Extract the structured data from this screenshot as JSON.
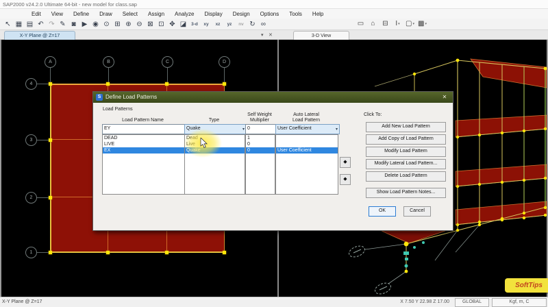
{
  "window": {
    "title": "SAP2000 v24.2.0 Ultimate 64-bit - new model for class.sap"
  },
  "menu": {
    "items": [
      "Edit",
      "View",
      "Define",
      "Draw",
      "Select",
      "Assign",
      "Analyze",
      "Display",
      "Design",
      "Options",
      "Tools",
      "Help"
    ]
  },
  "toolbar": {
    "left_icons": [
      {
        "name": "pointer",
        "glyph": "↖"
      },
      {
        "name": "save",
        "glyph": "▦"
      },
      {
        "name": "print",
        "glyph": "▤"
      },
      {
        "name": "undo",
        "glyph": "↶"
      },
      {
        "name": "redo",
        "glyph": "↷"
      },
      {
        "name": "draw",
        "glyph": "✎"
      },
      {
        "name": "lock",
        "glyph": "◙"
      },
      {
        "name": "run-analysis",
        "glyph": "▶"
      },
      {
        "name": "snap-point",
        "glyph": "◉"
      },
      {
        "name": "snap-line",
        "glyph": "⊙"
      },
      {
        "name": "zoom-window",
        "glyph": "⊞"
      },
      {
        "name": "zoom-in",
        "glyph": "⊕"
      },
      {
        "name": "zoom-out",
        "glyph": "⊖"
      },
      {
        "name": "zoom-full",
        "glyph": "⊠"
      },
      {
        "name": "zoom-previous",
        "glyph": "⊡"
      },
      {
        "name": "pan",
        "glyph": "✥"
      },
      {
        "name": "perspective",
        "glyph": "◪"
      },
      {
        "name": "view-3d",
        "glyph": "3-d"
      },
      {
        "name": "view-xy",
        "glyph": "xy"
      },
      {
        "name": "view-xz",
        "glyph": "xz"
      },
      {
        "name": "view-yz",
        "glyph": "yz"
      },
      {
        "name": "view-nv",
        "glyph": "nv"
      },
      {
        "name": "rotate-view",
        "glyph": "↻"
      },
      {
        "name": "show-options",
        "glyph": "∞"
      }
    ],
    "right_icons": [
      {
        "name": "draw-frame",
        "glyph": "▭"
      },
      {
        "name": "draw-quad",
        "glyph": "⌂"
      },
      {
        "name": "draw-grid",
        "glyph": "⊟"
      },
      {
        "name": "frame-section",
        "glyph": "I"
      },
      {
        "name": "area-section",
        "glyph": "▢"
      },
      {
        "name": "solid-section",
        "glyph": "▩"
      }
    ]
  },
  "icons": {
    "dropdown": "▾",
    "close": "✕",
    "tab_menu": "▾",
    "move_up": "◆",
    "move_down": "◆"
  },
  "tabs": {
    "left": "X-Y Plane @ Z=17",
    "right": "3-D View"
  },
  "plan_view": {
    "column_grids": [
      "A",
      "B",
      "C",
      "D"
    ],
    "row_grids": [
      "4",
      "3",
      "2",
      "1"
    ]
  },
  "dialog": {
    "logo": "S",
    "title": "Define Load Patterns",
    "group_label": "Load Patterns",
    "headers": {
      "name_l1": "",
      "name_l2": "Load Pattern Name",
      "type_l1": "",
      "type_l2": "Type",
      "mult_l1": "Self Weight",
      "mult_l2": "Multiplier",
      "auto_l1": "Auto Lateral",
      "auto_l2": "Load Pattern"
    },
    "edit_row": {
      "name": "EY",
      "type": "Quake",
      "multiplier": "0",
      "auto_lateral": "User Coefficient"
    },
    "rows": [
      {
        "name": "DEAD",
        "type": "Dead",
        "multiplier": "1",
        "auto_lateral": ""
      },
      {
        "name": "LIVE",
        "type": "Live",
        "multiplier": "0",
        "auto_lateral": ""
      },
      {
        "name": "EX",
        "type": "Quake",
        "multiplier": "0",
        "auto_lateral": "User Coefficient"
      }
    ],
    "click_to": "Click To:",
    "buttons": [
      "Add New Load Pattern",
      "Add Copy of Load Pattern",
      "Modify Load Pattern",
      "Modify Lateral Load Pattern...",
      "Delete Load Pattern",
      "Show Load Pattern Notes..."
    ],
    "ok": "OK",
    "cancel": "Cancel"
  },
  "status": {
    "left": "X-Y Plane @ Z=17",
    "coords": "X 7.50   Y 22.98   Z 17.00",
    "csys": "GLOBAL",
    "units": "Kgf, m, C"
  },
  "watermark": "SoftTips",
  "colors": {
    "slab_red": "#8e1106",
    "grid_yellow": "#ffe60a",
    "selection_blue": "#2f87e0",
    "dialog_title_green": "#46541f",
    "highlight_yellow": "#f2e23c"
  }
}
